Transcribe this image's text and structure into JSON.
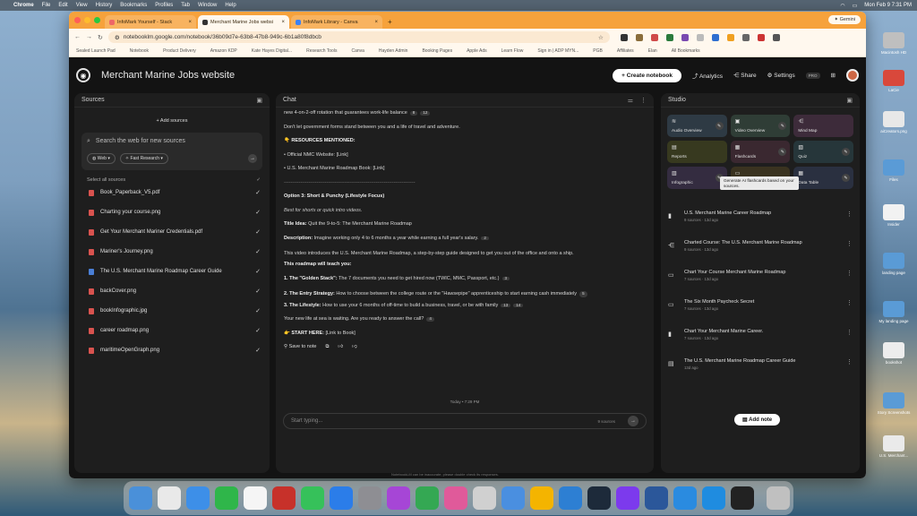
{
  "menubar": {
    "items": [
      "Chrome",
      "File",
      "Edit",
      "View",
      "History",
      "Bookmarks",
      "Profiles",
      "Tab",
      "Window",
      "Help"
    ],
    "clock": "Mon Feb 9  7:31 PM"
  },
  "browser": {
    "tabs": [
      {
        "label": "InfoMark Yourself - Stack"
      },
      {
        "label": "Merchant Marine Jobs websi"
      },
      {
        "label": "InfoMark Library - Canva"
      }
    ],
    "gemini_label": "Gemini",
    "url": "notebooklm.google.com/notebook/36b09d7e-63b8-47b8-949c-6b1a80f8dbcb",
    "bookmarks": [
      "Sealed Launch Pad",
      "Notebook",
      "Product Delivery",
      "Amazon KDP",
      "Kate Hayes Digital...",
      "Research Tools",
      "Canva",
      "Hayden Admin",
      "Booking Pages",
      "Apple Ads",
      "Learn Flow",
      "Sign in | ADP MYN...",
      "PGB",
      "Affiliates",
      "Elan",
      "All Bookmarks"
    ]
  },
  "app": {
    "notebook_title": "Merchant Marine Jobs website",
    "create_notebook": "Create notebook",
    "analytics": "Analytics",
    "share": "Share",
    "settings": "Settings",
    "pro": "PRO"
  },
  "sources": {
    "title": "Sources",
    "add_sources": "+ Add sources",
    "search_placeholder": "Search the web for new sources",
    "chip_web": "Web",
    "chip_research": "Fast Research",
    "select_all": "Select all sources",
    "items": [
      {
        "name": "Book_Paperback_V5.pdf",
        "type": "pdf"
      },
      {
        "name": "Charting your course.png",
        "type": "img"
      },
      {
        "name": "Get Your Merchant Mariner Credentials.pdf",
        "type": "pdf"
      },
      {
        "name": "Mariner's Journey.png",
        "type": "img"
      },
      {
        "name": "The U.S. Merchant Marine Roadmap Career Guide",
        "type": "doc"
      },
      {
        "name": "backCover.png",
        "type": "img"
      },
      {
        "name": "bookInfographic.jpg",
        "type": "img"
      },
      {
        "name": "career roadmap.png",
        "type": "img"
      },
      {
        "name": "maritimeOpenGraph.png",
        "type": "img"
      }
    ]
  },
  "chat": {
    "title": "Chat",
    "lines": {
      "l1": "new 4-on-2-off rotation that guarantees work-life balance",
      "l1_c1": "8",
      "l1_c2": "12",
      "l2": "Don't let government forms stand between you and a life of travel and adventure.",
      "l3": "👇 RESOURCES MENTIONED:",
      "l4": "• Official NMC Website: [Link]",
      "l5": "• U.S. Merchant Marine Roadmap Book: [Link]",
      "divider": "--------------------------------------------------------------------------------",
      "opt3": "Option 3: Short & Punchy (Lifestyle Focus)",
      "best": "Best for shorts or quick intro videos.",
      "idea_label": "Title Idea:",
      "idea": " Quit the 9-to-5: The Merchant Marine Roadmap",
      "desc_label": "Description:",
      "desc": " Imagine working only 4 to 6 months a year while earning a full year's salary.",
      "desc_c": "2",
      "intro": "This video introduces the U.S. Merchant Marine Roadmap, a step-by-step guide designed to get you out of the office and onto a ship.",
      "teach": "This roadmap will teach you:",
      "p1_label": "1. The \"Golden Stack\":",
      "p1": " The 7 documents you need to get hired now (TWIC, MMC, Passport, etc.)",
      "p1_c": "3",
      "p2_label": "2. The Entry Strategy:",
      "p2": " How to choose between the college route or the \"Hawsepipe\" apprenticeship to start earning cash immediately",
      "p2_c": "5",
      "p3_label": "3. The Lifestyle:",
      "p3": " How to use your 6 months of off-time to build a business, travel, or be with family",
      "p3_c1": "13",
      "p3_c2": "14",
      "closing": "Your new life at sea is waiting. Are you ready to answer the call?",
      "closing_c": "4",
      "start": "👉 START HERE:",
      "start_link": " [Link to Book]"
    },
    "save_to_note": "Save to note",
    "today": "Today • 7:29 PM",
    "input_placeholder": "Start typing...",
    "source_count": "9 sources"
  },
  "studio": {
    "title": "Studio",
    "tiles": [
      {
        "label": "Audio Overview",
        "color": "#2e3a44",
        "icon": "≋"
      },
      {
        "label": "Video Overview",
        "color": "#2f3d36",
        "icon": "▣"
      },
      {
        "label": "Mind Map",
        "color": "#3d2b3a",
        "icon": "⋲"
      },
      {
        "label": "Reports",
        "color": "#37391f",
        "icon": "▤"
      },
      {
        "label": "Flashcards",
        "color": "#3a2830",
        "icon": "▦"
      },
      {
        "label": "Quiz",
        "color": "#26363a",
        "icon": "▧"
      },
      {
        "label": "Infographic",
        "color": "#342c40",
        "icon": "▥"
      },
      {
        "label": "Slide Deck",
        "color": "#3a3320",
        "icon": "▭"
      },
      {
        "label": "Data Table",
        "color": "#2a3040",
        "icon": "▦"
      }
    ],
    "tooltip": "Generate AI flashcards based on your sources.",
    "artifacts": [
      {
        "title": "U.S. Merchant Marine Career Roadmap",
        "meta": "9 sources · 13d ago",
        "icon": "▮"
      },
      {
        "title": "Charted Course: The U.S. Merchant Marine Roadmap",
        "meta": "9 sources · 13d ago",
        "icon": "⋲"
      },
      {
        "title": "Chart Your Course Merchant Marine Roadmap",
        "meta": "7 sources · 13d ago",
        "icon": "▭"
      },
      {
        "title": "The Six Month Paycheck Secret",
        "meta": "7 sources · 13d ago",
        "icon": "▭"
      },
      {
        "title": "Chart Your Merchant Marine Career.",
        "meta": "7 sources · 13d ago",
        "icon": "▮"
      },
      {
        "title": "The U.S. Merchant Marine Roadmap Career Guide",
        "meta": "13d ago",
        "icon": "▤"
      }
    ],
    "add_note": "Add note"
  },
  "footer_note": "NotebookLM can be inaccurate; please double check its responses.",
  "desktop": [
    {
      "label": "Macintosh HD"
    },
    {
      "label": "LaCie"
    },
    {
      "label": "aiCreators.png"
    },
    {
      "label": "Files"
    },
    {
      "label": "Insider"
    },
    {
      "label": "landing page"
    },
    {
      "label": "My landing page"
    },
    {
      "label": "bookshot"
    },
    {
      "label": "Story Screenshots"
    },
    {
      "label": "U.S. Merchant..."
    }
  ]
}
